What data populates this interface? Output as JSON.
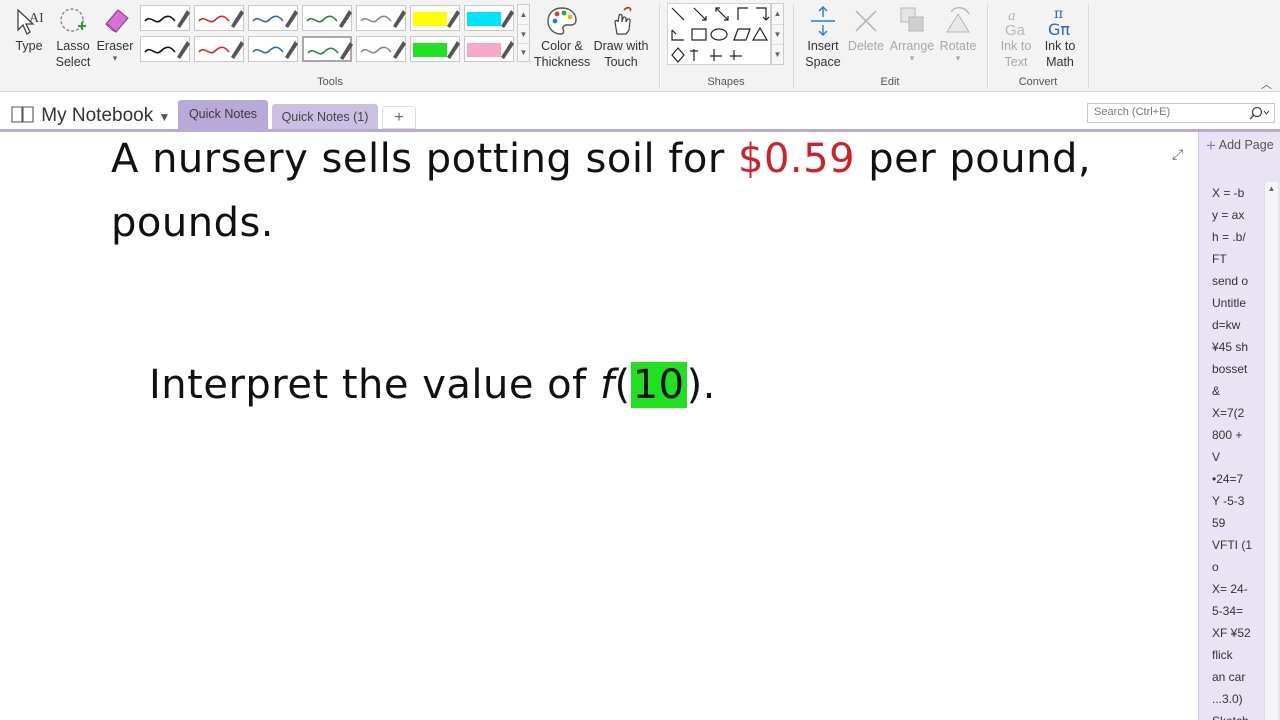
{
  "ribbon": {
    "type": "Type",
    "lasso": "Lasso\nSelect",
    "eraser": "Eraser",
    "eraser_dd": "▾",
    "tools_label": "Tools",
    "color_thickness": "Color &\nThickness",
    "draw_touch": "Draw with\nTouch",
    "shapes_label": "Shapes",
    "insert_space": "Insert\nSpace",
    "delete": "Delete",
    "arrange": "Arrange",
    "rotate": "Rotate",
    "edit_label": "Edit",
    "ink_text": "Ink to\nText",
    "ink_math": "Ink to\nMath",
    "convert_label": "Convert"
  },
  "pens": [
    {
      "color": "#111111",
      "kind": "pen"
    },
    {
      "color": "#d42a2a",
      "kind": "pen"
    },
    {
      "color": "#2a6ab4",
      "kind": "pen"
    },
    {
      "color": "#1e8a3a",
      "kind": "pen"
    },
    {
      "color": "#8a8a8a",
      "kind": "pen"
    },
    {
      "color": "#ffff00",
      "kind": "highlighter"
    },
    {
      "color": "#00e5ff",
      "kind": "highlighter"
    },
    {
      "color": "#111111",
      "kind": "pen"
    },
    {
      "color": "#d42a2a",
      "kind": "pen"
    },
    {
      "color": "#2a6ab4",
      "kind": "pen"
    },
    {
      "color": "#1e8a3a",
      "kind": "pen",
      "selected": true
    },
    {
      "color": "#8a8a8a",
      "kind": "pen"
    },
    {
      "color": "#22e022",
      "kind": "highlighter"
    },
    {
      "color": "#f7a8c8",
      "kind": "highlighter"
    }
  ],
  "notebook": {
    "title": "My Notebook",
    "tabs": [
      "Quick Notes",
      "Quick Notes (1)"
    ],
    "add_tab": "+",
    "search_placeholder": "Search (Ctrl+E)"
  },
  "page": {
    "line1_a": "A nursery sells potting soil for ",
    "line1_price": "$0.59",
    "line1_b": " per pound, ",
    "line2": "pounds.",
    "q_a": "Interpret the value of ",
    "q_f": "f",
    "q_open": "(",
    "q_arg": "10",
    "q_close": ")."
  },
  "pane": {
    "add_page": "Add Page",
    "pages": [
      "X = -b",
      "y = ax",
      "h = .b/",
      "FT",
      "send o",
      "Untitle",
      "d=kw",
      "¥45 sh",
      "bosset",
      "&",
      "X=7(2",
      "800 +",
      "V",
      "•24=7",
      "Y -5-3",
      "59",
      "VFTI (1",
      "o",
      "X= 24-",
      "5-34=",
      "XF ¥52",
      "flick",
      "an car",
      "...3.0)",
      "Sketch"
    ]
  }
}
